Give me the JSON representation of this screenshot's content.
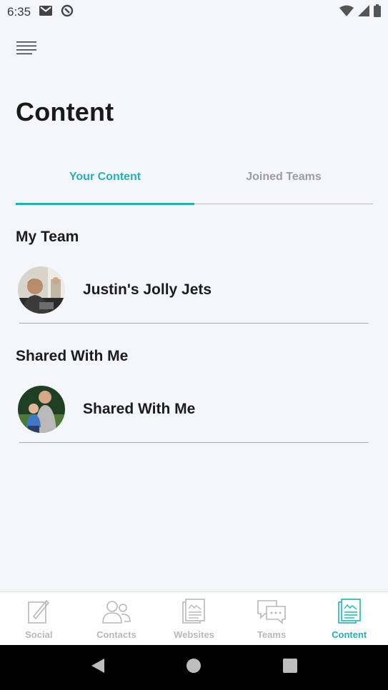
{
  "status_bar": {
    "time": "6:35",
    "icons": [
      "mail-icon",
      "data-saver-icon",
      "wifi-icon",
      "signal-icon",
      "battery-icon"
    ]
  },
  "header": {
    "menu_icon": "menu-icon",
    "title": "Content"
  },
  "tabs": [
    {
      "label": "Your Content",
      "active": true
    },
    {
      "label": "Joined Teams",
      "active": false
    }
  ],
  "sections": {
    "my_team": {
      "title": "My Team",
      "items": [
        {
          "label": "Justin's Jolly Jets"
        }
      ]
    },
    "shared": {
      "title": "Shared With Me",
      "items": [
        {
          "label": "Shared With Me"
        }
      ]
    }
  },
  "bottom_nav": [
    {
      "label": "Social",
      "icon": "social-icon",
      "active": false
    },
    {
      "label": "Contacts",
      "icon": "contacts-icon",
      "active": false
    },
    {
      "label": "Websites",
      "icon": "websites-icon",
      "active": false
    },
    {
      "label": "Teams",
      "icon": "teams-icon",
      "active": false
    },
    {
      "label": "Content",
      "icon": "content-icon",
      "active": true
    }
  ],
  "colors": {
    "accent": "#1fb3b6",
    "background": "#f4f6fb",
    "inactive": "#b6b8bc"
  }
}
